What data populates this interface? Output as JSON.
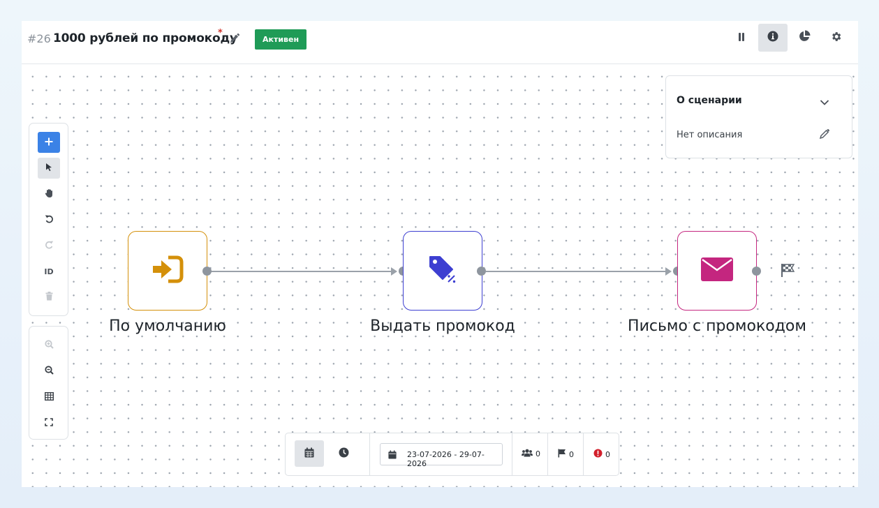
{
  "header": {
    "scenario_number": "#26",
    "scenario_title": "1000 рублей по промокоду",
    "required_mark": "*",
    "status_badge": "Активен",
    "status_color": "#1f9b57",
    "actions": [
      {
        "name": "pause-icon"
      },
      {
        "name": "info-icon",
        "active": true
      },
      {
        "name": "pie-chart-icon"
      },
      {
        "name": "gear-icon"
      }
    ]
  },
  "toolbar": {
    "tools": [
      "plus-icon",
      "pointer-icon",
      "hand-icon",
      "undo-icon",
      "redo-icon",
      "ID",
      "trash-icon"
    ],
    "id_label": "ID",
    "view_tools": [
      "zoom-in-icon",
      "zoom-out-icon",
      "grid-icon",
      "fullscreen-icon"
    ]
  },
  "info_panel": {
    "title": "О сценарии",
    "description": "Нет описания"
  },
  "nodes": [
    {
      "label": "По умолчанию",
      "icon": "sign-in-icon",
      "color": "#d4900a"
    },
    {
      "label": "Выдать промокод",
      "icon": "tag-percent-icon",
      "color": "#3d3fd1"
    },
    {
      "label": "Письмо с промокодом",
      "icon": "envelope-icon",
      "color": "#c4267f"
    }
  ],
  "end_marker_icon": "checkered-flag-icon",
  "bottom_bar": {
    "date_range": "23-07-2026 - 29-07-2026",
    "users_count": "0",
    "goals_count": "0",
    "errors_count": "0"
  }
}
